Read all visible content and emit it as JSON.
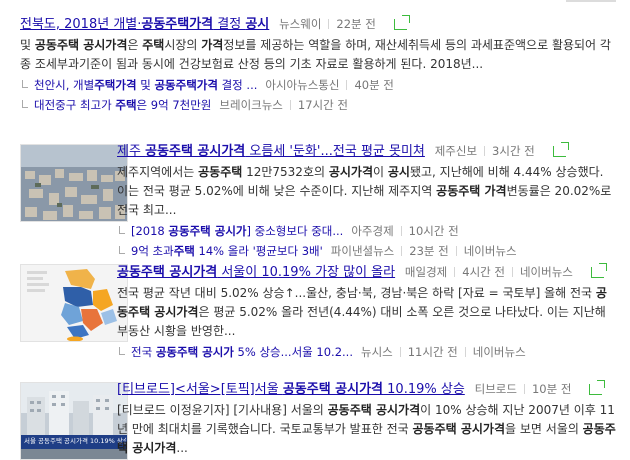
{
  "results": [
    {
      "title_pre": "전북도, 2018년 개별·",
      "title_bold": "공동주택가격",
      "title_post": " 결정 ",
      "title_bold2": "공시",
      "source": "뉴스웨이",
      "time": "22분 전",
      "desc": [
        {
          "t": "및 "
        },
        {
          "t": "공동주택 공시가격",
          "b": true
        },
        {
          "t": "은 "
        },
        {
          "t": "주택",
          "b": true
        },
        {
          "t": "시장의 "
        },
        {
          "t": "가격",
          "b": true
        },
        {
          "t": "정보를 제공하는 역할을 하며, 재산세취득세 등의 과세표준액으로 활용되어 각종 조세부과기준이 됨과 동시에 건강보험료 산정 등의 기초 자료로 활용하게 된다. 2018년..."
        }
      ],
      "subs": [
        {
          "parts": [
            {
              "t": "천안시, 개별"
            },
            {
              "t": "주택가격",
              "b": true
            },
            {
              "t": " 및 "
            },
            {
              "t": "공동주택가격",
              "b": true
            },
            {
              "t": " 결정 ..."
            }
          ],
          "source": "아시아뉴스통신",
          "time": "40분 전"
        },
        {
          "parts": [
            {
              "t": "대전중구 최고가 "
            },
            {
              "t": "주택",
              "b": true
            },
            {
              "t": "은 9억 7천만원"
            }
          ],
          "source": "브레이크뉴스",
          "time": "17시간 전"
        }
      ]
    },
    {
      "title_pre": "제주 ",
      "title_bold": "공동주택 공시가격",
      "title_post": " 오름세 '둔화'...전국 평균 못미쳐",
      "title_bold2": "",
      "source": "제주신보",
      "time": "3시간 전",
      "desc": [
        {
          "t": "제주지역에서는 "
        },
        {
          "t": "공동주택",
          "b": true
        },
        {
          "t": " 12만7532호의 "
        },
        {
          "t": "공시가격",
          "b": true
        },
        {
          "t": "이 "
        },
        {
          "t": "공시",
          "b": true
        },
        {
          "t": "됐고, 지난해에 비해 4.44% 상승했다. 이는 전국 평균 5.02%에 비해 낮은 수준이다. 지난해 제주지역 "
        },
        {
          "t": "공동주택 가격",
          "b": true
        },
        {
          "t": "변동률은 20.02%로 전국 최고..."
        }
      ],
      "subs": [
        {
          "parts": [
            {
              "t": "[2018 "
            },
            {
              "t": "공동주택 공시가",
              "b": true
            },
            {
              "t": "] 중소형보다 중대..."
            }
          ],
          "source": "아주경제",
          "time": "10시간 전"
        },
        {
          "parts": [
            {
              "t": "9억 초과"
            },
            {
              "t": "주택",
              "b": true
            },
            {
              "t": " 14% 올라 '평균보다 3배'"
            }
          ],
          "source": "파이낸셜뉴스",
          "time": "23분 전",
          "extra": "네이버뉴스"
        }
      ]
    },
    {
      "title_pre": "",
      "title_bold": "공동주택 공시가격",
      "title_post": " 서울이 10.19% 가장 많이 올라",
      "title_bold2": "",
      "source": "매일경제",
      "time": "4시간 전",
      "extra": "네이버뉴스",
      "desc": [
        {
          "t": "전국 평균 작년 대비 5.02% 상승↑...울산, 충남·북, 경남·북은 하락 [자료 = 국토부] 올해 전국 "
        },
        {
          "t": "공동주택 공시가격",
          "b": true
        },
        {
          "t": "은 평균 5.02% 올라 전년(4.44%) 대비 소폭 오른 것으로 나타났다. 이는 지난해 부동산 시황을 반영한..."
        }
      ],
      "subs": [
        {
          "parts": [
            {
              "t": "전국 "
            },
            {
              "t": "공동주택 공시가",
              "b": true
            },
            {
              "t": " 5% 상승...서울 10.2..."
            }
          ],
          "source": "뉴시스",
          "time": "11시간 전",
          "extra": "네이버뉴스"
        }
      ]
    },
    {
      "title_pre": "[티브로드]<서울>[토픽]서울 ",
      "title_bold": "공동주택 공시가격",
      "title_post": " 10.19% 상승",
      "title_bold2": "",
      "source": "티브로드",
      "time": "10분 전",
      "desc": [
        {
          "t": "[티브로드 이정윤기자] [기사내용] 서울의 "
        },
        {
          "t": "공동주택 공시가격",
          "b": true
        },
        {
          "t": "이 10% 상승해 지난 2007년 이후 11년 만에 최대치를 기록했습니다. 국토교통부가 발표한 전국 "
        },
        {
          "t": "공동주택 공시가격",
          "b": true
        },
        {
          "t": "을 보면 서울의 "
        },
        {
          "t": "공동주택 공시가격",
          "b": true
        },
        {
          "t": "..."
        }
      ],
      "subs": [],
      "thumb_caption": "서울 공동주택 공시가격 10.19% 상승"
    }
  ]
}
